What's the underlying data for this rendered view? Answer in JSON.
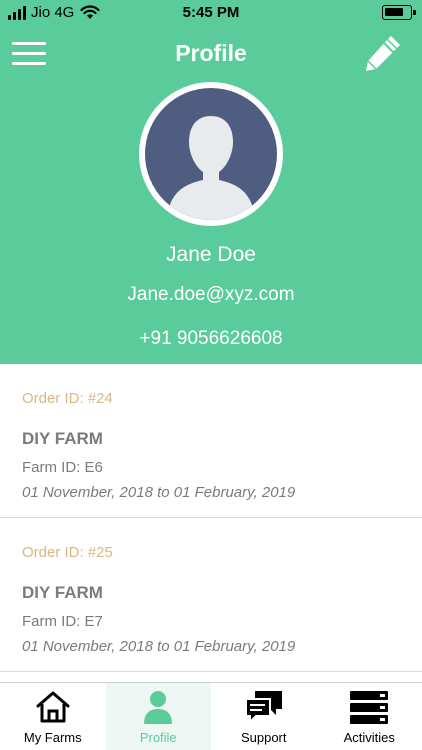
{
  "status_bar": {
    "carrier": "Jio 4G",
    "time": "5:45 PM"
  },
  "header": {
    "title": "Profile",
    "name": "Jane Doe",
    "email": "Jane.doe@xyz.com",
    "phone": "+91 9056626608"
  },
  "orders": [
    {
      "order_id": "Order ID: #24",
      "farm_name": "DIY FARM",
      "farm_id": "Farm ID: E6",
      "dates": "01 November, 2018 to 01 February, 2019"
    },
    {
      "order_id": "Order ID: #25",
      "farm_name": "DIY FARM",
      "farm_id": "Farm ID: E7",
      "dates": "01 November, 2018 to 01 February, 2019"
    }
  ],
  "tabs": [
    {
      "label": "My Farms",
      "icon": "home-icon"
    },
    {
      "label": "Profile",
      "icon": "user-icon",
      "active": true
    },
    {
      "label": "Support",
      "icon": "chat-icon"
    },
    {
      "label": "Activities",
      "icon": "list-icon"
    }
  ],
  "colors": {
    "accent": "#5acc9b",
    "order_id": "#d8b87f",
    "avatar_bg": "#4f5d81"
  }
}
